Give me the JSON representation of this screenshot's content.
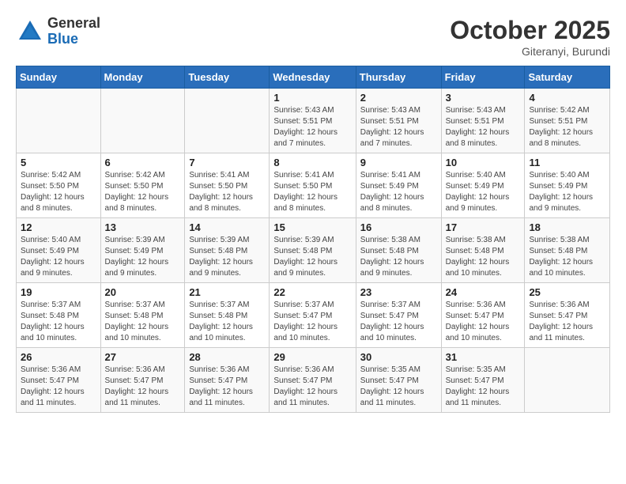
{
  "header": {
    "logo_general": "General",
    "logo_blue": "Blue",
    "month": "October 2025",
    "location": "Giteranyi, Burundi"
  },
  "weekdays": [
    "Sunday",
    "Monday",
    "Tuesday",
    "Wednesday",
    "Thursday",
    "Friday",
    "Saturday"
  ],
  "weeks": [
    [
      {
        "day": "",
        "info": ""
      },
      {
        "day": "",
        "info": ""
      },
      {
        "day": "",
        "info": ""
      },
      {
        "day": "1",
        "info": "Sunrise: 5:43 AM\nSunset: 5:51 PM\nDaylight: 12 hours\nand 7 minutes."
      },
      {
        "day": "2",
        "info": "Sunrise: 5:43 AM\nSunset: 5:51 PM\nDaylight: 12 hours\nand 7 minutes."
      },
      {
        "day": "3",
        "info": "Sunrise: 5:43 AM\nSunset: 5:51 PM\nDaylight: 12 hours\nand 8 minutes."
      },
      {
        "day": "4",
        "info": "Sunrise: 5:42 AM\nSunset: 5:51 PM\nDaylight: 12 hours\nand 8 minutes."
      }
    ],
    [
      {
        "day": "5",
        "info": "Sunrise: 5:42 AM\nSunset: 5:50 PM\nDaylight: 12 hours\nand 8 minutes."
      },
      {
        "day": "6",
        "info": "Sunrise: 5:42 AM\nSunset: 5:50 PM\nDaylight: 12 hours\nand 8 minutes."
      },
      {
        "day": "7",
        "info": "Sunrise: 5:41 AM\nSunset: 5:50 PM\nDaylight: 12 hours\nand 8 minutes."
      },
      {
        "day": "8",
        "info": "Sunrise: 5:41 AM\nSunset: 5:50 PM\nDaylight: 12 hours\nand 8 minutes."
      },
      {
        "day": "9",
        "info": "Sunrise: 5:41 AM\nSunset: 5:49 PM\nDaylight: 12 hours\nand 8 minutes."
      },
      {
        "day": "10",
        "info": "Sunrise: 5:40 AM\nSunset: 5:49 PM\nDaylight: 12 hours\nand 9 minutes."
      },
      {
        "day": "11",
        "info": "Sunrise: 5:40 AM\nSunset: 5:49 PM\nDaylight: 12 hours\nand 9 minutes."
      }
    ],
    [
      {
        "day": "12",
        "info": "Sunrise: 5:40 AM\nSunset: 5:49 PM\nDaylight: 12 hours\nand 9 minutes."
      },
      {
        "day": "13",
        "info": "Sunrise: 5:39 AM\nSunset: 5:49 PM\nDaylight: 12 hours\nand 9 minutes."
      },
      {
        "day": "14",
        "info": "Sunrise: 5:39 AM\nSunset: 5:48 PM\nDaylight: 12 hours\nand 9 minutes."
      },
      {
        "day": "15",
        "info": "Sunrise: 5:39 AM\nSunset: 5:48 PM\nDaylight: 12 hours\nand 9 minutes."
      },
      {
        "day": "16",
        "info": "Sunrise: 5:38 AM\nSunset: 5:48 PM\nDaylight: 12 hours\nand 9 minutes."
      },
      {
        "day": "17",
        "info": "Sunrise: 5:38 AM\nSunset: 5:48 PM\nDaylight: 12 hours\nand 10 minutes."
      },
      {
        "day": "18",
        "info": "Sunrise: 5:38 AM\nSunset: 5:48 PM\nDaylight: 12 hours\nand 10 minutes."
      }
    ],
    [
      {
        "day": "19",
        "info": "Sunrise: 5:37 AM\nSunset: 5:48 PM\nDaylight: 12 hours\nand 10 minutes."
      },
      {
        "day": "20",
        "info": "Sunrise: 5:37 AM\nSunset: 5:48 PM\nDaylight: 12 hours\nand 10 minutes."
      },
      {
        "day": "21",
        "info": "Sunrise: 5:37 AM\nSunset: 5:48 PM\nDaylight: 12 hours\nand 10 minutes."
      },
      {
        "day": "22",
        "info": "Sunrise: 5:37 AM\nSunset: 5:47 PM\nDaylight: 12 hours\nand 10 minutes."
      },
      {
        "day": "23",
        "info": "Sunrise: 5:37 AM\nSunset: 5:47 PM\nDaylight: 12 hours\nand 10 minutes."
      },
      {
        "day": "24",
        "info": "Sunrise: 5:36 AM\nSunset: 5:47 PM\nDaylight: 12 hours\nand 10 minutes."
      },
      {
        "day": "25",
        "info": "Sunrise: 5:36 AM\nSunset: 5:47 PM\nDaylight: 12 hours\nand 11 minutes."
      }
    ],
    [
      {
        "day": "26",
        "info": "Sunrise: 5:36 AM\nSunset: 5:47 PM\nDaylight: 12 hours\nand 11 minutes."
      },
      {
        "day": "27",
        "info": "Sunrise: 5:36 AM\nSunset: 5:47 PM\nDaylight: 12 hours\nand 11 minutes."
      },
      {
        "day": "28",
        "info": "Sunrise: 5:36 AM\nSunset: 5:47 PM\nDaylight: 12 hours\nand 11 minutes."
      },
      {
        "day": "29",
        "info": "Sunrise: 5:36 AM\nSunset: 5:47 PM\nDaylight: 12 hours\nand 11 minutes."
      },
      {
        "day": "30",
        "info": "Sunrise: 5:35 AM\nSunset: 5:47 PM\nDaylight: 12 hours\nand 11 minutes."
      },
      {
        "day": "31",
        "info": "Sunrise: 5:35 AM\nSunset: 5:47 PM\nDaylight: 12 hours\nand 11 minutes."
      },
      {
        "day": "",
        "info": ""
      }
    ]
  ]
}
